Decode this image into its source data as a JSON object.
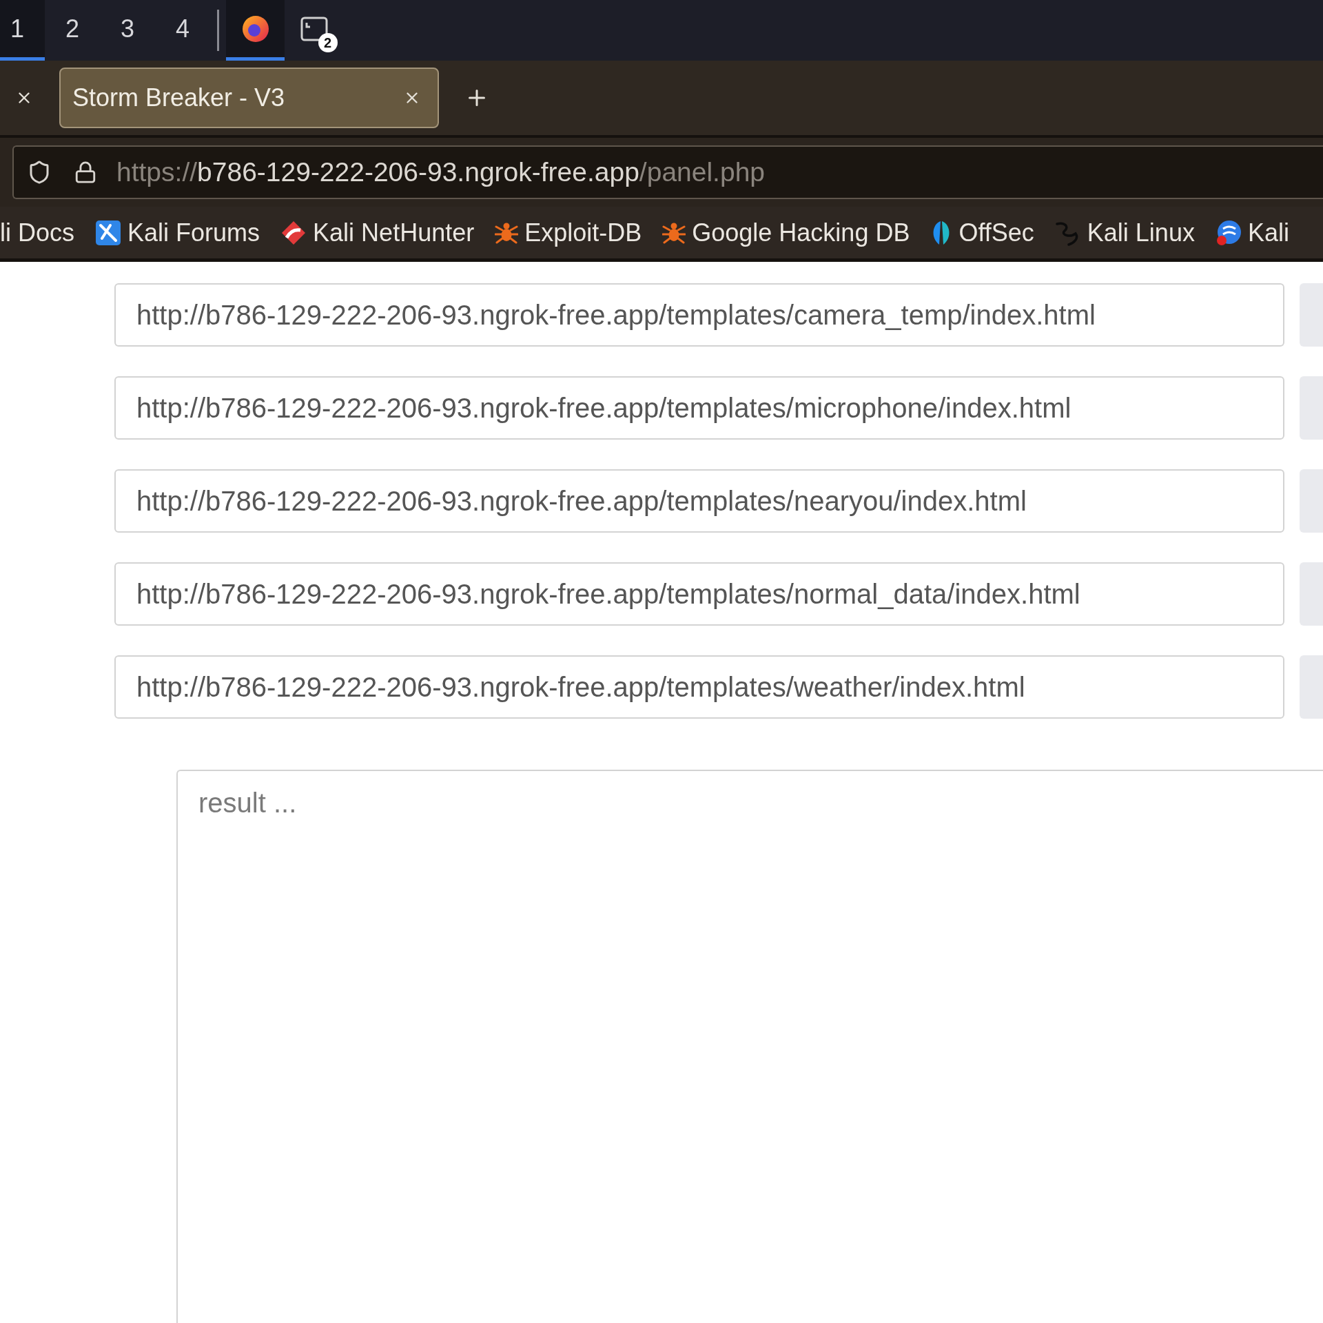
{
  "taskbar": {
    "workspaces": [
      {
        "label": "1",
        "selected": true
      },
      {
        "label": "2",
        "selected": false
      },
      {
        "label": "3",
        "selected": false
      },
      {
        "label": "4",
        "selected": false
      }
    ],
    "apps": [
      {
        "kind": "browser",
        "selected": true
      },
      {
        "kind": "terminal",
        "selected": false,
        "badge": "2"
      }
    ]
  },
  "tabs": [
    {
      "selected": false
    },
    {
      "title": "Storm Breaker - V3",
      "selected": true
    }
  ],
  "address_bar": {
    "scheme": "https://",
    "host": "b786-129-222-206-93.ngrok-free.app",
    "path": "/panel.php"
  },
  "bookmarks": [
    {
      "label": "li Docs",
      "kind": "plain"
    },
    {
      "label": "Kali Forums",
      "kind": "tile"
    },
    {
      "label": "Kali NetHunter",
      "kind": "swoosh"
    },
    {
      "label": "Exploit-DB",
      "kind": "bug"
    },
    {
      "label": "Google Hacking DB",
      "kind": "bug"
    },
    {
      "label": "OffSec",
      "kind": "leaf"
    },
    {
      "label": "Kali Linux",
      "kind": "dragon"
    },
    {
      "label": "Kali",
      "kind": "globe"
    }
  ],
  "links": [
    "http://b786-129-222-206-93.ngrok-free.app/templates/camera_temp/index.html",
    "http://b786-129-222-206-93.ngrok-free.app/templates/microphone/index.html",
    "http://b786-129-222-206-93.ngrok-free.app/templates/nearyou/index.html",
    "http://b786-129-222-206-93.ngrok-free.app/templates/normal_data/index.html",
    "http://b786-129-222-206-93.ngrok-free.app/templates/weather/index.html"
  ],
  "result": {
    "placeholder": "result ..."
  }
}
